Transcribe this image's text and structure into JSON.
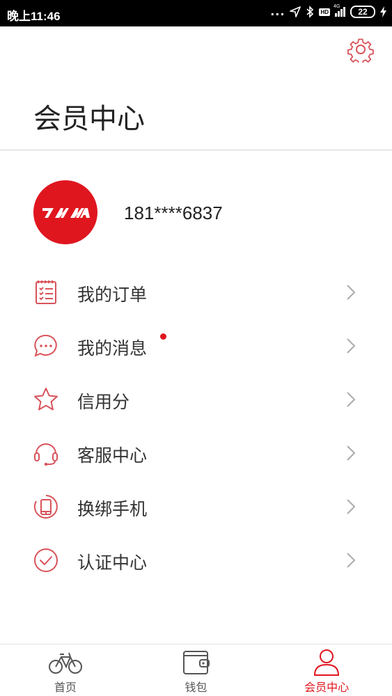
{
  "status_bar": {
    "time": "晚上11:46",
    "dots": "...",
    "hd": "HD",
    "network": "4G",
    "battery": "22"
  },
  "header": {
    "title": "会员中心"
  },
  "profile": {
    "logo_text": "TMA",
    "phone": "181****6837"
  },
  "menu": {
    "items": [
      {
        "label": "我的订单",
        "icon": "order-list-icon"
      },
      {
        "label": "我的消息",
        "icon": "message-bubble-icon",
        "badge": true
      },
      {
        "label": "信用分",
        "icon": "star-icon"
      },
      {
        "label": "客服中心",
        "icon": "headset-icon"
      },
      {
        "label": "换绑手机",
        "icon": "phone-icon"
      },
      {
        "label": "认证中心",
        "icon": "check-circle-icon"
      }
    ]
  },
  "tabbar": {
    "tabs": [
      {
        "label": "首页",
        "icon": "bicycle-icon",
        "active": false
      },
      {
        "label": "钱包",
        "icon": "wallet-icon",
        "active": false
      },
      {
        "label": "会员中心",
        "icon": "user-icon",
        "active": true
      }
    ]
  },
  "colors": {
    "accent": "#e0161f",
    "icon_stroke": "#d9535a",
    "tab_inactive": "#555555"
  }
}
